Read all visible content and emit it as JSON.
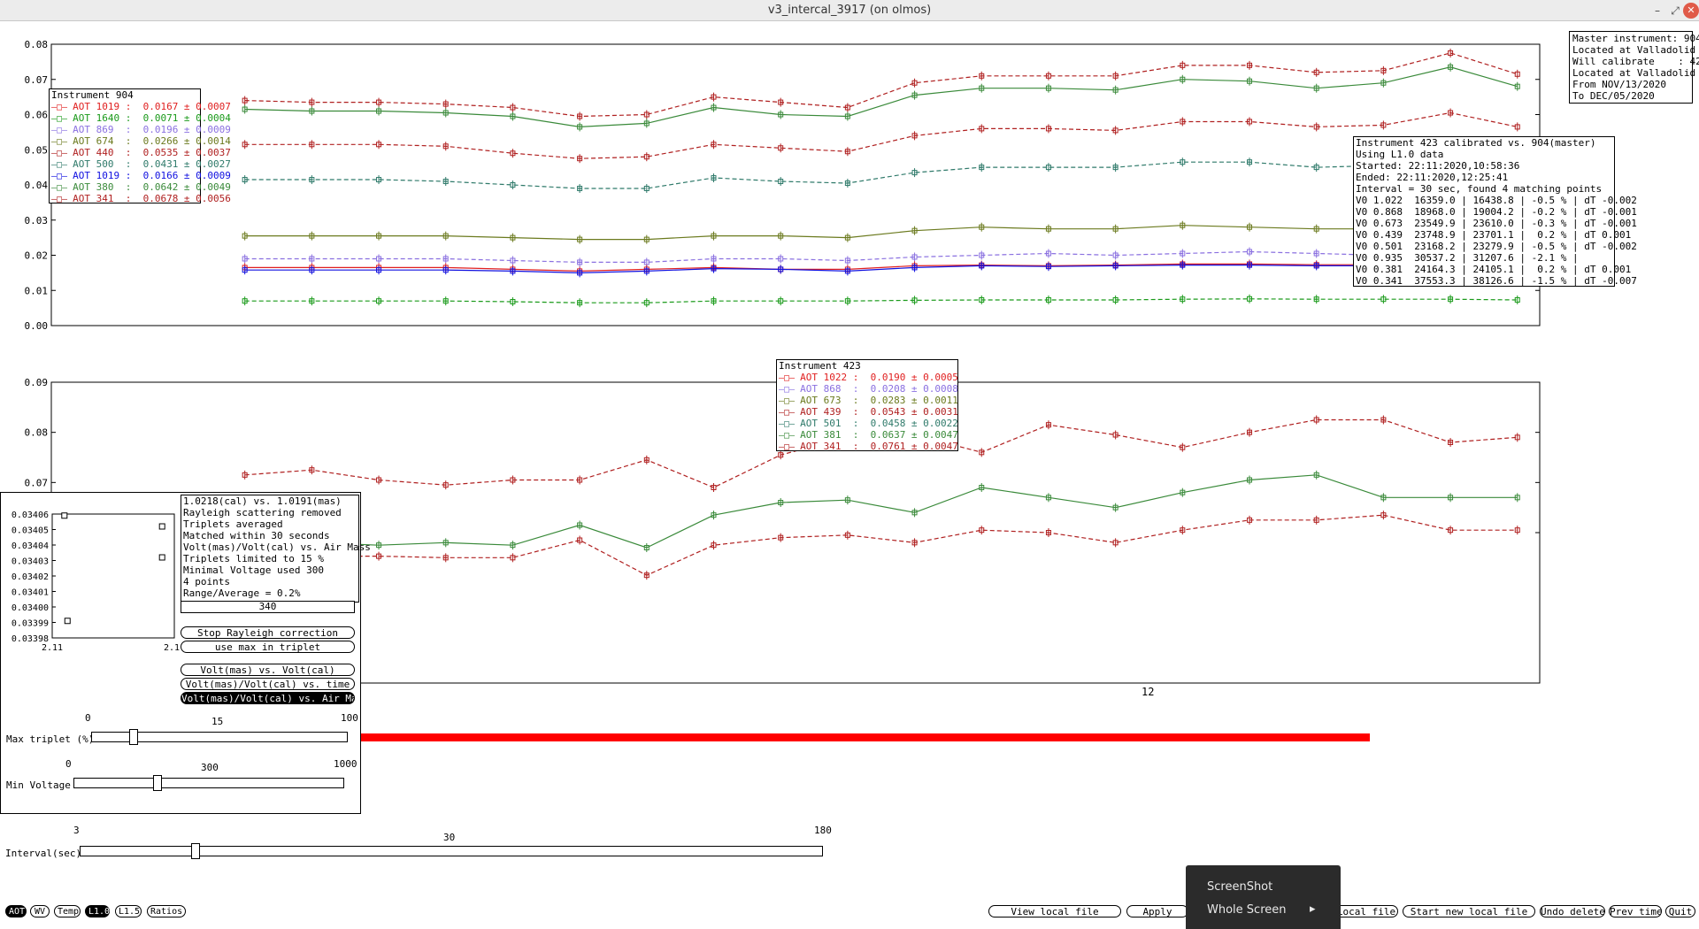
{
  "window": {
    "title": "v3_intercal_3917 (on olmos)",
    "min_glyph": "–",
    "max_glyph": "⤢",
    "close_glyph": "✕"
  },
  "colors": {
    "red": "#e02020",
    "green": "#1a9a1a",
    "violet": "#8a70e0",
    "olive": "#6b7a1e",
    "darkred": "#b02020",
    "teal": "#2f7a6a",
    "blue": "#1010e0",
    "darkgreen": "#3a8a3a",
    "slider_bar": "#ff0000"
  },
  "master_info": [
    "Master instrument: 904",
    "Located at Valladolid",
    "Will calibrate    : 423",
    "Located at Valladolid",
    "From NOV/13/2020",
    "To DEC/05/2020"
  ],
  "legend_904": {
    "title": "Instrument 904",
    "rows": [
      {
        "label": "AOT 1019 :",
        "value": "0.0167 ± 0.0007",
        "color": "red",
        "icon": "square-marker-icon"
      },
      {
        "label": "AOT 1640 :",
        "value": "0.0071 ± 0.0004",
        "color": "green",
        "icon": "triangle-down-marker-icon"
      },
      {
        "label": "AOT 869  :",
        "value": "0.0196 ± 0.0009",
        "color": "violet",
        "icon": "x-marker-icon"
      },
      {
        "label": "AOT 674  :",
        "value": "0.0266 ± 0.0014",
        "color": "olive",
        "icon": "triangle-up-marker-icon"
      },
      {
        "label": "AOT 440  :",
        "value": "0.0535 ± 0.0037",
        "color": "darkred",
        "icon": "square-marker-icon"
      },
      {
        "label": "AOT 500  :",
        "value": "0.0431 ± 0.0027",
        "color": "teal",
        "icon": "triangle-down-marker-icon"
      },
      {
        "label": "AOT 1019 :",
        "value": "0.0166 ± 0.0009",
        "color": "blue",
        "icon": "triangle-up-marker-icon"
      },
      {
        "label": "AOT 380  :",
        "value": "0.0642 ± 0.0049",
        "color": "darkgreen",
        "icon": "x-marker-icon"
      },
      {
        "label": "AOT 341  :",
        "value": "0.0678 ± 0.0056",
        "color": "darkred",
        "icon": "star-marker-icon"
      }
    ]
  },
  "legend_423": {
    "title": "Instrument 423",
    "rows": [
      {
        "label": "AOT 1022 :",
        "value": "0.0190 ± 0.0005",
        "color": "red",
        "icon": "square-marker-icon"
      },
      {
        "label": "AOT 868  :",
        "value": "0.0208 ± 0.0008",
        "color": "violet",
        "icon": "x-marker-icon"
      },
      {
        "label": "AOT 673  :",
        "value": "0.0283 ± 0.0011",
        "color": "olive",
        "icon": "triangle-up-marker-icon"
      },
      {
        "label": "AOT 439  :",
        "value": "0.0543 ± 0.0031",
        "color": "darkred",
        "icon": "square-marker-icon"
      },
      {
        "label": "AOT 501  :",
        "value": "0.0458 ± 0.0022",
        "color": "teal",
        "icon": "triangle-down-marker-icon"
      },
      {
        "label": "AOT 381  :",
        "value": "0.0637 ± 0.0047",
        "color": "darkgreen",
        "icon": "x-marker-icon"
      },
      {
        "label": "AOT 341  :",
        "value": "0.0761 ± 0.0047",
        "color": "darkred",
        "icon": "star-marker-icon"
      }
    ]
  },
  "calib_info": [
    "Instrument 423 calibrated vs. 904(master)",
    "Using L1.0 data",
    "Started: 22:11:2020,10:58:36",
    "Ended: 22:11:2020,12:25:41",
    "Interval = 30 sec, found 4 matching points",
    "V0 1.022  16359.0 | 16438.8 | -0.5 % | dT -0.002",
    "V0 0.868  18968.0 | 19004.2 | -0.2 % | dT -0.001",
    "V0 0.673  23549.9 | 23610.0 | -0.3 % | dT -0.001",
    "V0 0.439  23748.9 | 23701.1 |  0.2 % | dT 0.001",
    "V0 0.501  23168.2 | 23279.9 | -0.5 % | dT -0.002",
    "V0 0.935  30537.2 | 31207.6 | -2.1 % |",
    "V0 0.381  24164.3 | 24105.1 |  0.2 % | dT 0.001",
    "V0 0.341  37553.3 | 38126.6 | -1.5 % | dT -0.007"
  ],
  "chart_data": [
    {
      "type": "line",
      "id": "instrument-904",
      "ylim": [
        0,
        0.08
      ],
      "yticks": [
        "0.08",
        "0.07",
        "0.06",
        "0.05",
        "0.04",
        "0.03",
        "0.02",
        "0.01",
        "0.00"
      ],
      "x": [
        1,
        2,
        3,
        4,
        5,
        6,
        7,
        8,
        9,
        10,
        11,
        12,
        13,
        14,
        15,
        16,
        17,
        18,
        19,
        20,
        21,
        22,
        23
      ],
      "series": [
        {
          "name": "AOT 341",
          "color": "darkred",
          "dashed": true,
          "values": [
            0.064,
            0.0635,
            0.0635,
            0.063,
            0.062,
            0.0595,
            0.06,
            0.065,
            0.0635,
            0.062,
            0.069,
            0.071,
            0.071,
            0.071,
            0.074,
            0.074,
            0.072,
            0.0725,
            0.0775,
            0.0715
          ]
        },
        {
          "name": "AOT 380",
          "color": "darkgreen",
          "dashed": false,
          "values": [
            0.0615,
            0.061,
            0.061,
            0.0605,
            0.0595,
            0.0565,
            0.0575,
            0.062,
            0.06,
            0.0595,
            0.0655,
            0.0675,
            0.0675,
            0.067,
            0.07,
            0.0695,
            0.0675,
            0.069,
            0.0735,
            0.068
          ]
        },
        {
          "name": "AOT 440",
          "color": "darkred",
          "dashed": true,
          "values": [
            0.0515,
            0.0515,
            0.0515,
            0.051,
            0.049,
            0.0475,
            0.048,
            0.0515,
            0.0505,
            0.0495,
            0.054,
            0.056,
            0.056,
            0.0555,
            0.058,
            0.058,
            0.0565,
            0.057,
            0.0605,
            0.0565
          ]
        },
        {
          "name": "AOT 500",
          "color": "teal",
          "dashed": true,
          "values": [
            0.0415,
            0.0415,
            0.0415,
            0.041,
            0.04,
            0.039,
            0.039,
            0.042,
            0.041,
            0.0405,
            0.0435,
            0.045,
            0.045,
            0.045,
            0.0465,
            0.0465,
            0.045,
            0.0455,
            0.0485,
            0.0475
          ]
        },
        {
          "name": "AOT 674",
          "color": "olive",
          "dashed": false,
          "values": [
            0.0255,
            0.0255,
            0.0255,
            0.0255,
            0.025,
            0.0245,
            0.0245,
            0.0255,
            0.0255,
            0.025,
            0.027,
            0.028,
            0.0275,
            0.0275,
            0.0285,
            0.028,
            0.0275,
            0.0275,
            0.029,
            0.029
          ]
        },
        {
          "name": "AOT 869",
          "color": "violet",
          "dashed": true,
          "values": [
            0.019,
            0.019,
            0.019,
            0.019,
            0.0185,
            0.018,
            0.018,
            0.019,
            0.019,
            0.0185,
            0.0195,
            0.02,
            0.0205,
            0.02,
            0.0205,
            0.021,
            0.0205,
            0.02,
            0.021,
            0.021
          ]
        },
        {
          "name": "AOT 1019",
          "color": "red",
          "dashed": false,
          "values": [
            0.0165,
            0.0165,
            0.0165,
            0.0165,
            0.016,
            0.0155,
            0.016,
            0.0165,
            0.016,
            0.016,
            0.017,
            0.0172,
            0.017,
            0.0172,
            0.0175,
            0.0175,
            0.0173,
            0.0173,
            0.018,
            0.018
          ]
        },
        {
          "name": "AOT 1019",
          "color": "blue",
          "dashed": false,
          "values": [
            0.0158,
            0.0158,
            0.0158,
            0.0158,
            0.0155,
            0.015,
            0.0155,
            0.0162,
            0.016,
            0.0155,
            0.0165,
            0.017,
            0.0168,
            0.017,
            0.0172,
            0.0172,
            0.017,
            0.017,
            0.0178,
            0.0178
          ]
        },
        {
          "name": "AOT 1640",
          "color": "green",
          "dashed": true,
          "values": [
            0.007,
            0.007,
            0.007,
            0.007,
            0.0068,
            0.0065,
            0.0065,
            0.007,
            0.007,
            0.007,
            0.0072,
            0.0073,
            0.0073,
            0.0073,
            0.0075,
            0.0076,
            0.0075,
            0.0075,
            0.0075,
            0.0073
          ]
        }
      ]
    },
    {
      "type": "line",
      "id": "instrument-423",
      "ylim": [
        0.03,
        0.09
      ],
      "yticks": [
        "0.09",
        "0.08",
        "0.07",
        "0.06"
      ],
      "series": [
        {
          "name": "AOT 341",
          "color": "darkred",
          "dashed": true,
          "values": [
            0.0715,
            0.0725,
            0.0705,
            0.0695,
            0.0705,
            0.0705,
            0.0745,
            0.069,
            0.0755,
            0.079,
            0.0795,
            0.076,
            0.0815,
            0.0795,
            0.077,
            0.08,
            0.0825,
            0.0825,
            0.078,
            0.079
          ]
        },
        {
          "name": "AOT 381",
          "color": "darkgreen",
          "dashed": false,
          "values": [
            0.0595,
            0.058,
            0.0575,
            0.058,
            0.0575,
            0.0615,
            0.057,
            0.0635,
            0.066,
            0.0665,
            0.064,
            0.069,
            0.067,
            0.065,
            0.068,
            0.0705,
            0.0715,
            0.067,
            0.067,
            0.067
          ]
        },
        {
          "name": "AOT 439",
          "color": "darkred",
          "dashed": true,
          "values": [
            0.0555,
            0.0553,
            0.0553,
            0.055,
            0.055,
            0.0585,
            0.0515,
            0.0575,
            0.059,
            0.0595,
            0.058,
            0.0605,
            0.06,
            0.058,
            0.0605,
            0.0625,
            0.0625,
            0.0635,
            0.0605,
            0.0605
          ]
        }
      ]
    }
  ],
  "x_axis_marker": "12",
  "regression_panel": {
    "yticks": [
      "0.03406",
      "0.03405",
      "0.03404",
      "0.03403",
      "0.03402",
      "0.03401",
      "0.03400",
      "0.03399",
      "0.03398"
    ],
    "xticks": [
      "2.11",
      "2.13"
    ],
    "points": [
      [
        2.112,
        0.034059
      ],
      [
        2.128,
        0.034052
      ],
      [
        2.128,
        0.034032
      ],
      [
        2.1125,
        0.033991
      ]
    ]
  },
  "info_lines": [
    "1.0218(cal) vs. 1.0191(mas)",
    "Rayleigh scattering removed",
    "Triplets averaged",
    "Matched within 30 seconds",
    "Volt(mas)/Volt(cal) vs. Air Mass",
    "Triplets limited to 15 %",
    "Minimal Voltage used 300",
    "4 points",
    "Range/Average = 0.2%"
  ],
  "wavelength_field": "340",
  "buttons": {
    "stop_rayleigh": "Stop Rayleigh correction",
    "use_max": "use max in triplet",
    "volt_vs_volt": "Volt(mas) vs. Volt(cal)",
    "ratio_vs_time": "Volt(mas)/Volt(cal) vs. time",
    "ratio_vs_airmass": "Volt(mas)/Volt(cal) vs. Air Mass"
  },
  "sliders": {
    "max_triplet": {
      "label": "Max triplet (%)",
      "min": "0",
      "max": "100",
      "value": "15",
      "fraction": 0.15
    },
    "min_voltage": {
      "label": "Min Voltage",
      "min": "0",
      "max": "1000",
      "value": "300",
      "fraction": 0.3
    },
    "interval": {
      "label": "Interval(sec)",
      "min": "3",
      "max": "180",
      "value": "30",
      "fraction": 0.15
    }
  },
  "progress_fraction": 0.95,
  "mode_chips": [
    "AOT",
    "WV",
    "Temp",
    "L1.0",
    "L1.5",
    "Ratios"
  ],
  "bottom_buttons": [
    "View local file",
    "Apply",
    "Local file",
    "Start new local file",
    "Undo delete",
    "Prev time",
    "Quit"
  ],
  "context_menu": {
    "item1": "ScreenShot",
    "item2": "Whole Screen",
    "arrow": "▸"
  }
}
